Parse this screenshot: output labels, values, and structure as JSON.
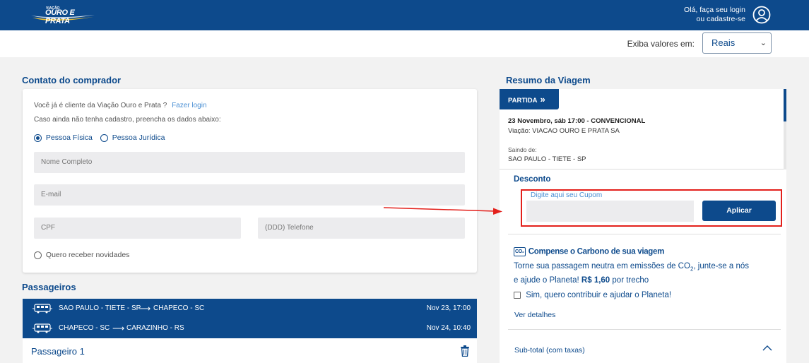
{
  "header": {
    "logo_small": "VIAÇÃO",
    "logo_text": "OURO E PRATA",
    "login_line1": "Olá, faça seu login",
    "login_line2": "ou cadastre-se"
  },
  "currency": {
    "label": "Exiba valores em:",
    "selected": "Reais"
  },
  "contact": {
    "title": "Contato do comprador",
    "already_client": "Você já é cliente da Viação Ouro e Prata ?",
    "login_link": "Fazer login",
    "no_account": "Caso ainda não tenha cadastro, preencha os dados abaixo:",
    "person_physical": "Pessoa Física",
    "person_legal": "Pessoa Jurídica",
    "placeholders": {
      "name": "Nome Completo",
      "email": "E-mail",
      "cpf": "CPF",
      "phone": "(DDD) Telefone"
    },
    "newsletter": "Quero receber novidades"
  },
  "passengers": {
    "title": "Passageiros",
    "routes": [
      {
        "from": "SAO PAULO - TIETE - SP",
        "to": "CHAPECO - SC",
        "date": "Nov 23, 17:00"
      },
      {
        "from": "CHAPECO - SC",
        "to": "CARAZINHO - RS",
        "date": "Nov 24, 10:40"
      }
    ],
    "passenger1": "Passageiro 1"
  },
  "summary": {
    "title": "Resumo da Viagem",
    "partida": "PARTIDA",
    "trip_date": "23 Novembro, sáb 17:00 - CONVENCIONAL",
    "company": "Viação: VIACAO OURO E PRATA SA",
    "departure_label": "Saindo de:",
    "departure_value": "SAO PAULO - TIETE - SP",
    "discount_title": "Desconto",
    "coupon_label": "Digite aqui seu Cupom",
    "apply_button": "Aplicar",
    "co2_badge": "CO₂",
    "co2_title": "Compense o Carbono de sua viagem",
    "co2_text_1": "Torne sua passagem neutra em emissões de CO",
    "co2_sub": "2",
    "co2_text_2": ", junte-se a nós e ajude o Planeta! ",
    "co2_price": "R$ 1,60",
    "co2_text_3": " por trecho",
    "contribute": "Sim, quero contribuir e ajudar o Planeta!",
    "details": "Ver detalhes",
    "subtotal": "Sub-total (com taxas)"
  },
  "colors": {
    "primary": "#0d4a8c",
    "annotation": "#e3201b",
    "link": "#4a8fd4"
  }
}
